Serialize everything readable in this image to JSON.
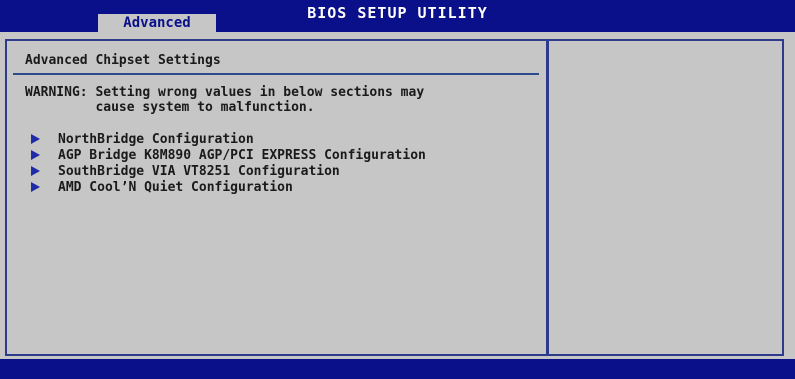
{
  "header": {
    "app_title": "BIOS SETUP UTILITY",
    "active_tab": "Advanced"
  },
  "main": {
    "title": "Advanced Chipset Settings",
    "warning_line1": "WARNING: Setting wrong values in below sections may",
    "warning_line2": "         cause system to malfunction.",
    "items": [
      {
        "label": "NorthBridge Configuration",
        "icon": "arrow-right-icon"
      },
      {
        "label": "AGP Bridge K8M890 AGP/PCI EXPRESS Configuration",
        "icon": "arrow-right-icon"
      },
      {
        "label": "SouthBridge VIA VT8251 Configuration",
        "icon": "arrow-right-icon"
      },
      {
        "label": "AMD Cool’N Quiet Configuration",
        "icon": "arrow-right-icon"
      }
    ]
  },
  "colors": {
    "header_bg": "#0a0f8a",
    "panel_bg": "#c6c6c6",
    "border": "#2e3a8c",
    "arrow": "#1f2ca8"
  }
}
